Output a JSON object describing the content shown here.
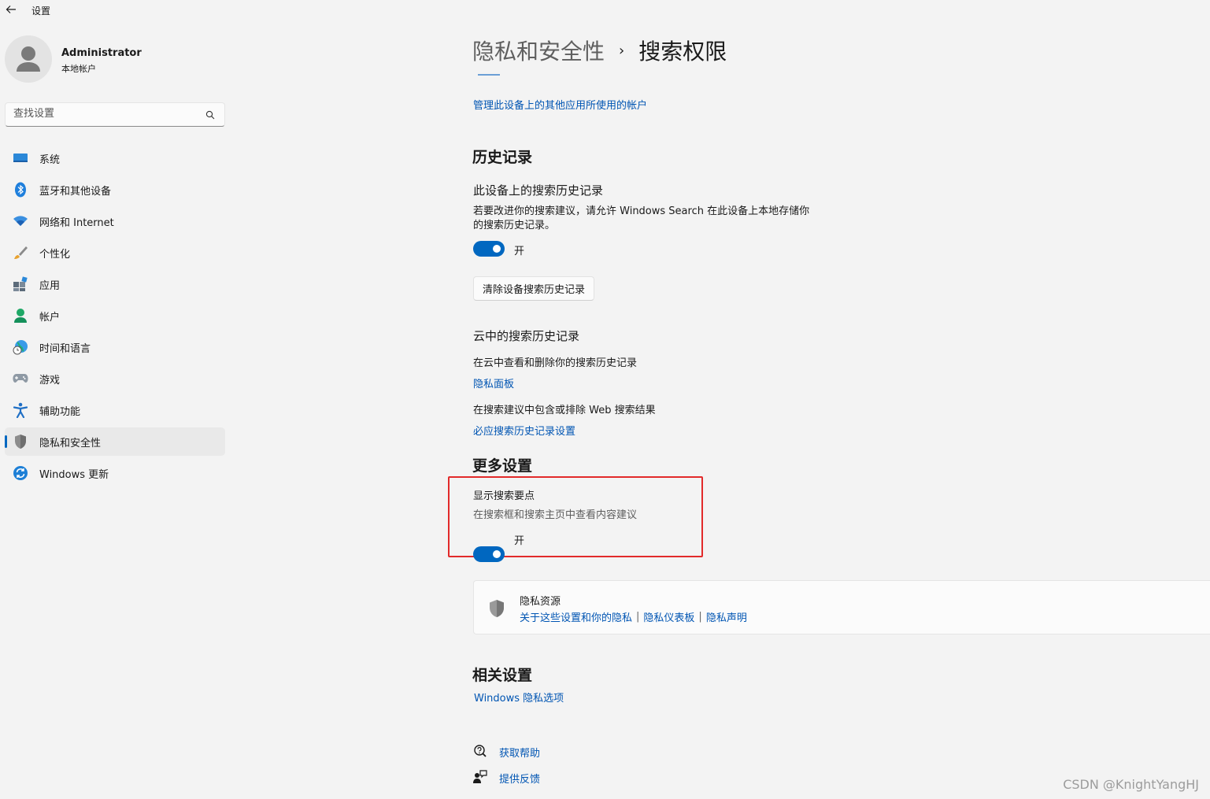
{
  "window": {
    "title": "设置"
  },
  "user": {
    "name": "Administrator",
    "type": "本地帐户"
  },
  "search": {
    "placeholder": "查找设置"
  },
  "sidebar": {
    "items": [
      {
        "label": "系统",
        "icon": "monitor-icon"
      },
      {
        "label": "蓝牙和其他设备",
        "icon": "bluetooth-icon"
      },
      {
        "label": "网络和 Internet",
        "icon": "wifi-icon"
      },
      {
        "label": "个性化",
        "icon": "brush-icon"
      },
      {
        "label": "应用",
        "icon": "apps-icon"
      },
      {
        "label": "帐户",
        "icon": "person-icon"
      },
      {
        "label": "时间和语言",
        "icon": "globe-clock-icon"
      },
      {
        "label": "游戏",
        "icon": "gamepad-icon"
      },
      {
        "label": "辅助功能",
        "icon": "accessibility-icon"
      },
      {
        "label": "隐私和安全性",
        "icon": "shield-icon",
        "active": true
      },
      {
        "label": "Windows 更新",
        "icon": "update-icon"
      }
    ]
  },
  "breadcrumb": {
    "parent": "隐私和安全性",
    "separator": "›",
    "current": "搜索权限"
  },
  "manage_accounts_link": "管理此设备上的其他应用所使用的帐户",
  "history": {
    "title": "历史记录",
    "device": {
      "title": "此设备上的搜索历史记录",
      "desc_line1": "若要改进你的搜索建议，请允许 Windows Search 在此设备上本地存储你",
      "desc_line2": "的搜索历史记录。",
      "toggle_state": "开",
      "clear_button": "清除设备搜索历史记录"
    },
    "cloud": {
      "title": "云中的搜索历史记录",
      "desc1": "在云中查看和删除你的搜索历史记录",
      "link1": "隐私面板",
      "desc2": "在搜索建议中包含或排除 Web 搜索结果",
      "link2": "必应搜索历史记录设置"
    }
  },
  "more_settings": {
    "title": "更多设置",
    "highlights": {
      "title": "显示搜索要点",
      "desc": "在搜索框和搜索主页中查看内容建议",
      "toggle_state": "开"
    }
  },
  "privacy_resources": {
    "title": "隐私资源",
    "links": [
      "关于这些设置和你的隐私",
      "隐私仪表板",
      "隐私声明"
    ],
    "separator": "|"
  },
  "related": {
    "title": "相关设置",
    "link": "Windows 隐私选项"
  },
  "help": {
    "get_help": "获取帮助",
    "feedback": "提供反馈"
  },
  "watermark": "CSDN @KnightYangHJ",
  "colors": {
    "accent": "#0067c0",
    "link": "#0055b3",
    "highlight_border": "#e22a2a",
    "background": "#f3f3f3"
  }
}
